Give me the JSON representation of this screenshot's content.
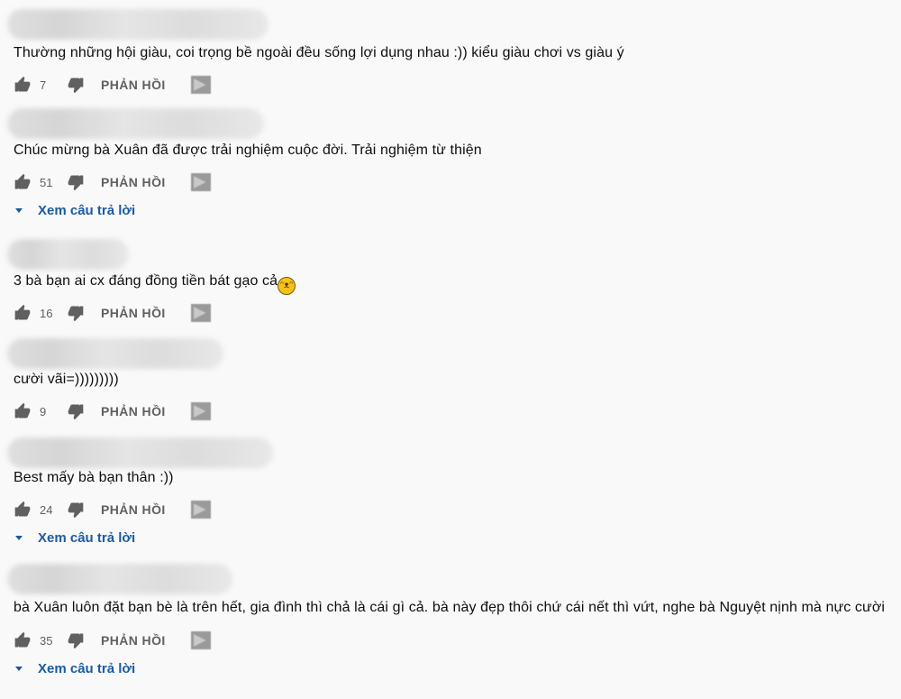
{
  "reply_label": "PHẢN HỒI",
  "view_replies_label": "Xem câu trả lời",
  "comments": [
    {
      "text": "Thường những hội giàu, coi trọng bề ngoài đều sống lợi dụng nhau :)) kiểu giàu chơi vs giàu ý",
      "likes": "7"
    },
    {
      "text": "Chúc mừng bà Xuân đã được trải nghiệm cuộc đời. Trải nghiệm từ thiện",
      "likes": "51"
    },
    {
      "text": "3 bà bạn ai cx đáng đồng tiền bát gạo cả",
      "likes": "16"
    },
    {
      "text": "cười vãi=)))))))))",
      "likes": "9"
    },
    {
      "text": "Best mấy bà bạn thân :))",
      "likes": "24"
    },
    {
      "text": "bà Xuân luôn đặt bạn bè là trên hết, gia đình thì chả là cái gì cả. bà này đẹp thôi chứ cái nết thì vứt, nghe bà Nguyệt nịnh mà nực cười",
      "likes": "35"
    }
  ],
  "colors": {
    "link": "#1a5b9f",
    "muted": "#606060",
    "background": "#f9f9f9"
  },
  "icons": [
    "thumb-up-icon",
    "thumb-down-icon",
    "flag-icon",
    "caret-down-icon",
    "laughing-emoji-icon"
  ]
}
